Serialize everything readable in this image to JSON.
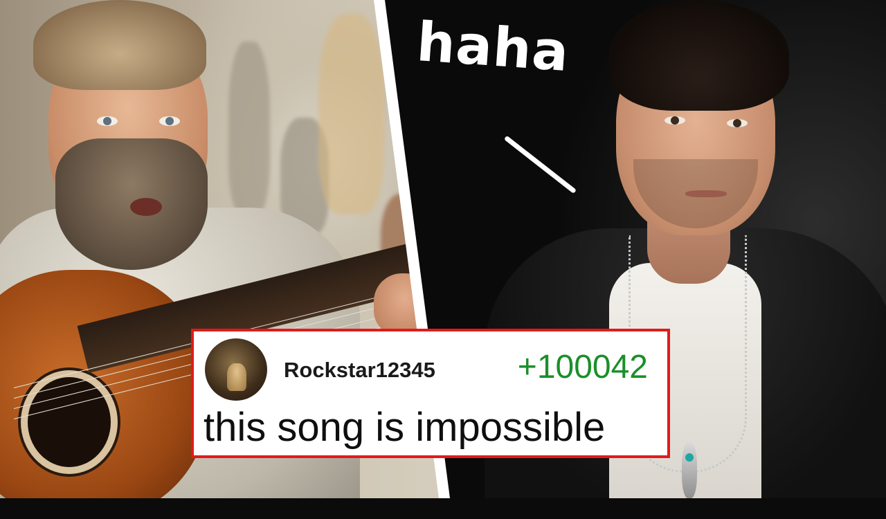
{
  "overlay": {
    "caption": "haha"
  },
  "comment": {
    "username": "Rockstar12345",
    "score": "+100042",
    "text": "this song is impossible",
    "avatar_icon": "user-avatar-icon"
  },
  "colors": {
    "card_border": "#e01b1b",
    "score_green": "#1b8f2a",
    "divider": "#ffffff",
    "caption": "#ffffff"
  }
}
